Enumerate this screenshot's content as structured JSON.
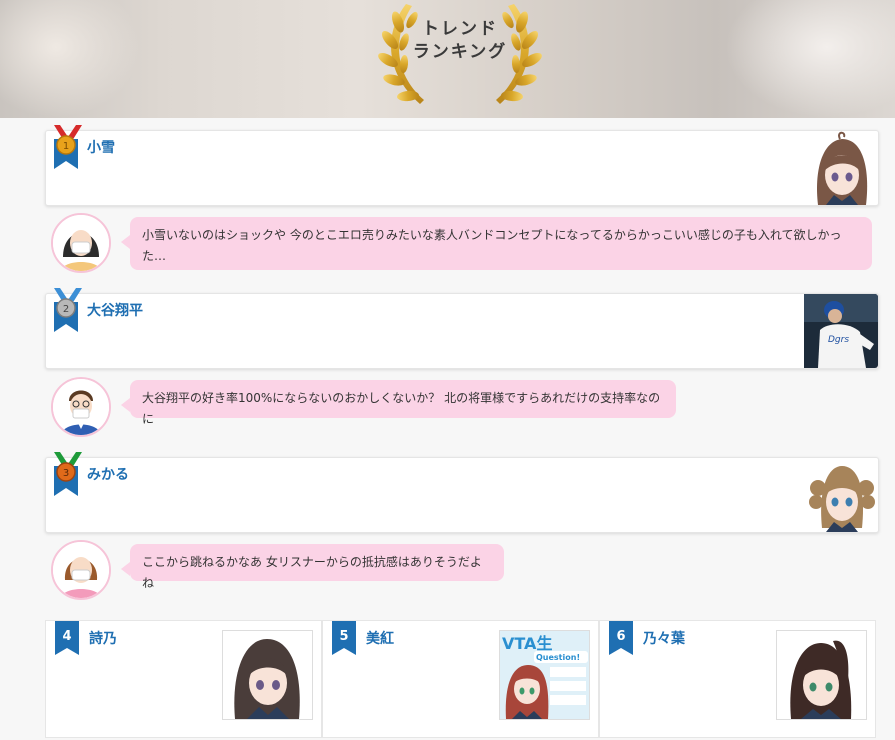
{
  "banner": {
    "title_line1": "トレンド",
    "title_line2": "ランキング"
  },
  "top_ranks": [
    {
      "rank": "1",
      "name": "小雪",
      "medal_color": "#e8a21b",
      "ribbon_color": "#1f6fb2",
      "strap_color": "#d62b2b",
      "comment": "小雪いないのはショックや 今のとこエロ売りみたいな素人バンドコンセプトになってるからかっこいい感じの子も入れて欲しかった…"
    },
    {
      "rank": "2",
      "name": "大谷翔平",
      "medal_color": "#a9a9a9",
      "ribbon_color": "#1f6fb2",
      "strap_color": "#1f6fb2",
      "comment": "大谷翔平の好き率100%にならないのおかしくないか？ 北の将軍様ですらあれだけの支持率なのに"
    },
    {
      "rank": "3",
      "name": "みかる",
      "medal_color": "#e06a1a",
      "ribbon_color": "#1f6fb2",
      "strap_color": "#1e9b3a",
      "comment": "ここから跳ねるかなあ 女リスナーからの抵抗感はありそうだよね"
    }
  ],
  "other_ranks": [
    {
      "rank": "4",
      "name": "詩乃"
    },
    {
      "rank": "5",
      "name": "美紅",
      "thumb_title": "VTA生",
      "thumb_sub": "Question!"
    },
    {
      "rank": "6",
      "name": "乃々葉"
    }
  ],
  "colors": {
    "accent": "#1f6fb2",
    "bubble": "#fbd3e6",
    "avatar_border": "#f6c4d8"
  }
}
